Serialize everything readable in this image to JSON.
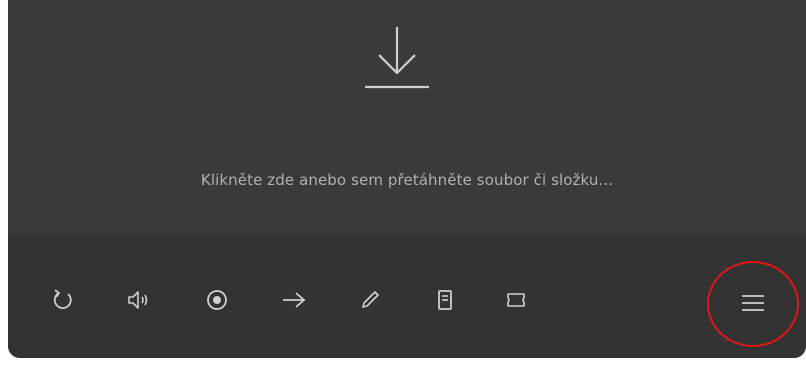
{
  "dropzone": {
    "hint": "Klikněte zde anebo sem přetáhněte soubor či složku...",
    "icon": "download-arrow-icon"
  },
  "toolbar": {
    "buttons": [
      {
        "name": "repeat",
        "icon": "refresh-icon"
      },
      {
        "name": "volume",
        "icon": "speaker-icon"
      },
      {
        "name": "record",
        "icon": "record-icon"
      },
      {
        "name": "next",
        "icon": "arrow-right-icon"
      },
      {
        "name": "edit",
        "icon": "pencil-icon"
      },
      {
        "name": "document",
        "icon": "document-icon"
      },
      {
        "name": "ticket",
        "icon": "ticket-icon"
      },
      {
        "name": "menu",
        "icon": "hamburger-menu-icon"
      }
    ]
  },
  "annotation": {
    "highlight_color": "#e0161b",
    "highlighted_element": "menu"
  },
  "colors": {
    "panel": "#3a3a3a",
    "toolbar": "#333333",
    "icon": "#d0d0d0",
    "hint_text": "#b0b0b0"
  }
}
